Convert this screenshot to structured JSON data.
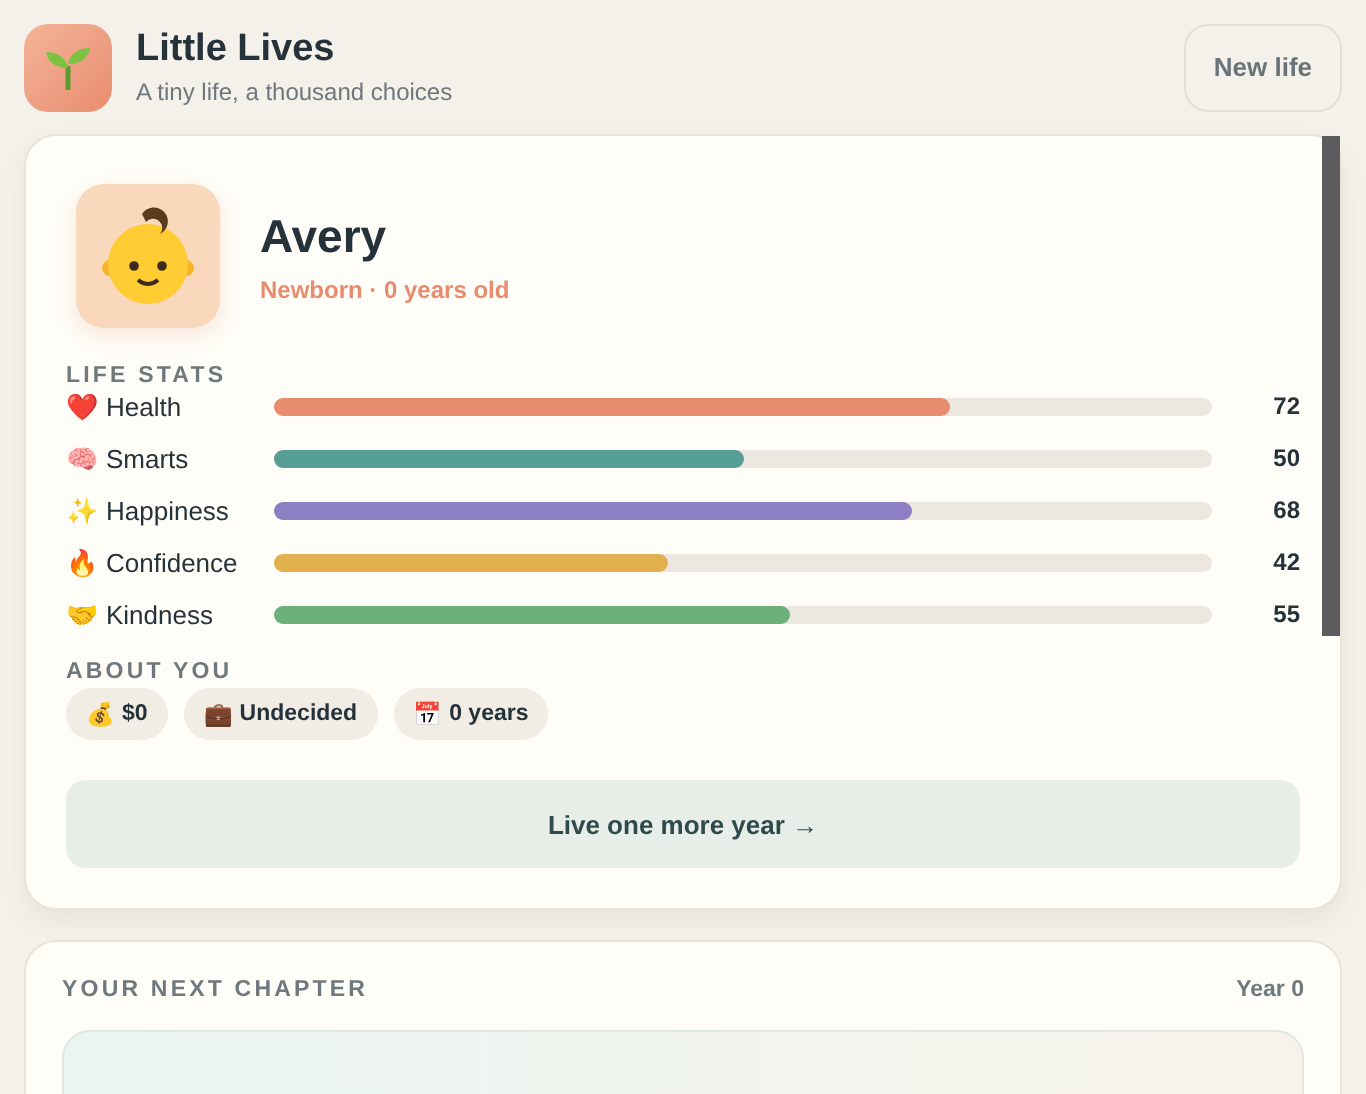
{
  "app": {
    "title": "Little Lives",
    "subtitle": "A tiny life, a thousand choices",
    "new_button": "New life"
  },
  "profile": {
    "name": "Avery",
    "status": "Newborn · 0 years old"
  },
  "life_stats": {
    "heading": "LIFE STATS",
    "stats": [
      {
        "icon": "❤️",
        "label": "Health",
        "level": 0.72,
        "value": "72",
        "color": "#e88c6e"
      },
      {
        "icon": "🧠",
        "label": "Smarts",
        "level": 0.5,
        "value": "50",
        "color": "#579e97"
      },
      {
        "icon": "✨",
        "label": "Happiness",
        "level": 0.68,
        "value": "68",
        "color": "#8d7fc4"
      },
      {
        "icon": "🔥",
        "label": "Confidence",
        "level": 0.42,
        "value": "42",
        "color": "#e2b04e"
      },
      {
        "icon": "🤝",
        "label": "Kindness",
        "level": 0.55,
        "value": "55",
        "color": "#6db07a"
      }
    ]
  },
  "about": {
    "heading": "ABOUT YOU",
    "chips": [
      {
        "icon": "💰",
        "label": "$0"
      },
      {
        "icon": "💼",
        "label": "Undecided"
      },
      {
        "icon": "📅",
        "label": "0 years"
      }
    ]
  },
  "advance_button": "Live one more year →",
  "next_chapter": {
    "heading": "YOUR NEXT CHAPTER",
    "year": "Year 0"
  }
}
